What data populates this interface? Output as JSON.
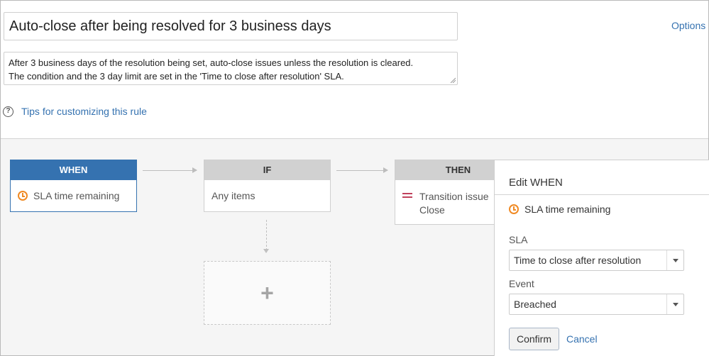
{
  "rule": {
    "title": "Auto-close after being resolved for 3 business days",
    "description_line1": "After 3 business days of the resolution being set, auto-close issues unless the resolution is cleared.",
    "description_line2": "The condition and the 3 day limit are set in the 'Time to close after resolution' SLA."
  },
  "header": {
    "options_label": "Options"
  },
  "tips": {
    "icon": "?",
    "label": "Tips for customizing this rule"
  },
  "flow": {
    "when": {
      "heading": "WHEN",
      "item": "SLA time remaining"
    },
    "if": {
      "heading": "IF",
      "item": "Any items"
    },
    "then": {
      "heading": "THEN",
      "item_line1": "Transition issue",
      "item_line2": "Close"
    },
    "add_symbol": "+"
  },
  "panel": {
    "title": "Edit WHEN",
    "trigger": "SLA time remaining",
    "sla_label": "SLA",
    "sla_value": "Time to close after resolution",
    "event_label": "Event",
    "event_value": "Breached",
    "confirm_label": "Confirm",
    "cancel_label": "Cancel"
  },
  "colors": {
    "accent_blue": "#3572b0",
    "clock_orange": "#f08a24",
    "transition_red": "#c0425c"
  }
}
